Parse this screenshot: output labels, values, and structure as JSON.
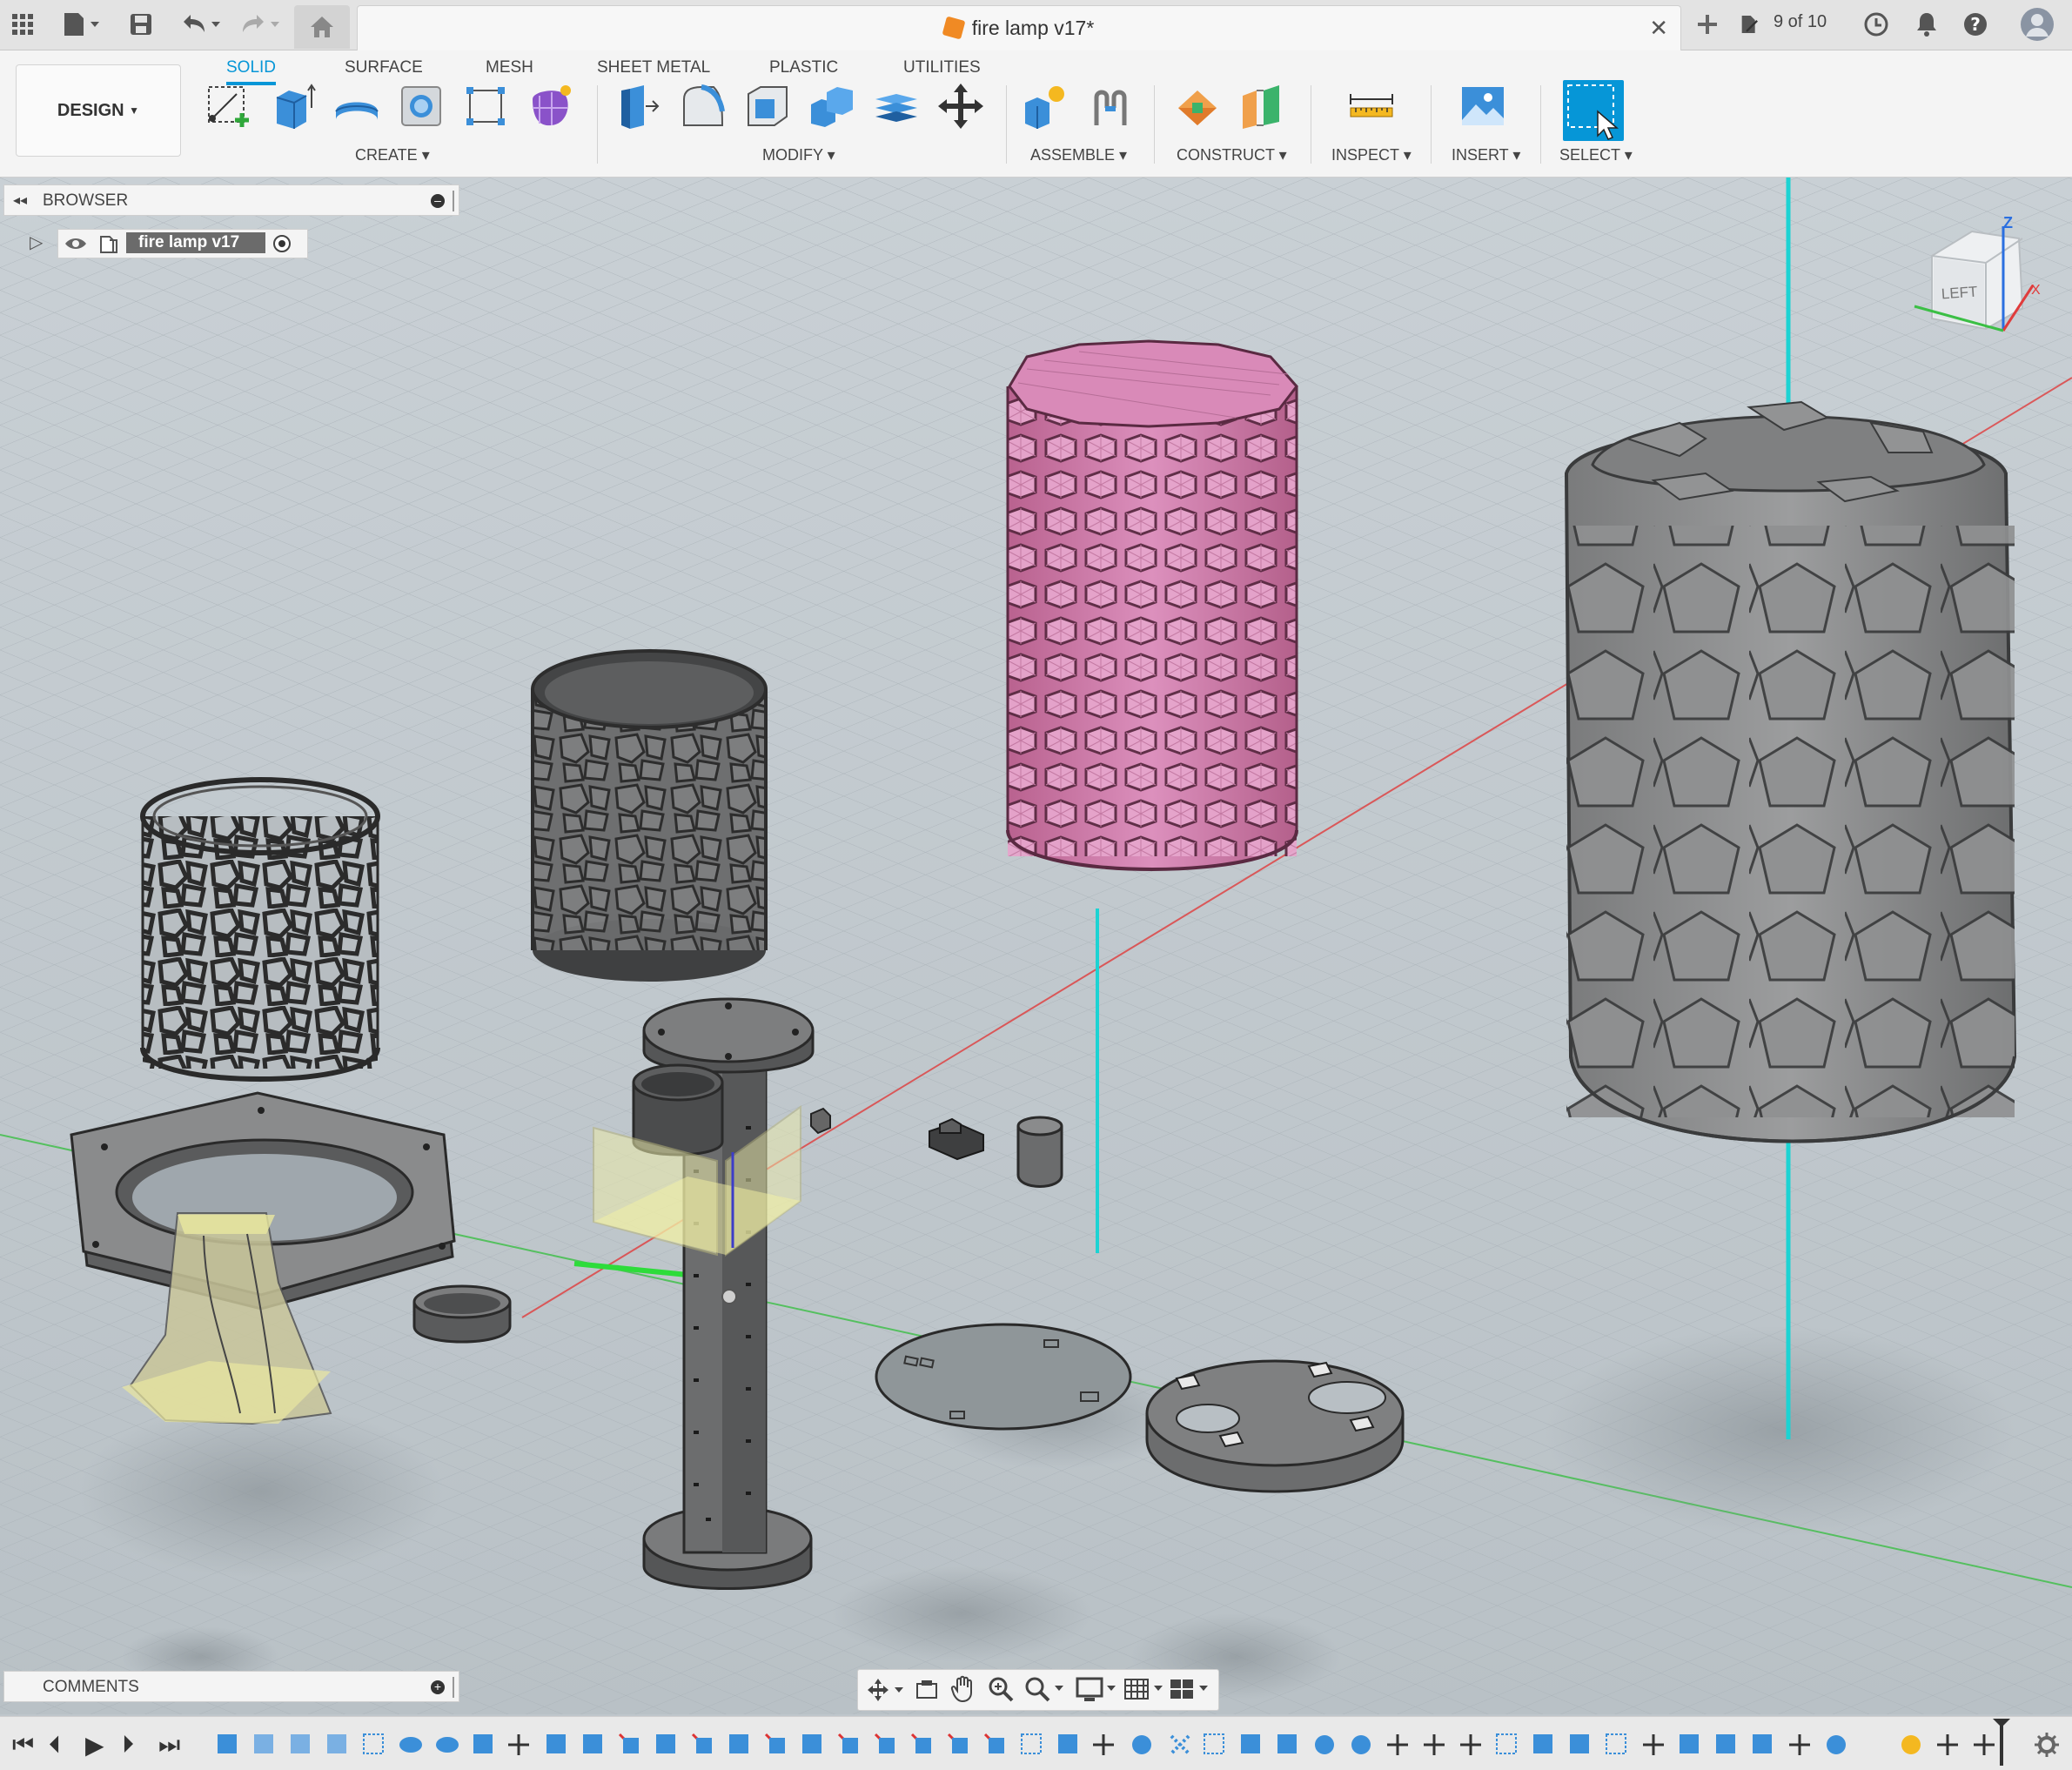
{
  "app": {
    "document_title": "fire lamp v17*",
    "job_status": "9 of 10"
  },
  "workspace": {
    "design_label": "DESIGN",
    "tabs": [
      "SOLID",
      "SURFACE",
      "MESH",
      "SHEET METAL",
      "PLASTIC",
      "UTILITIES"
    ],
    "active_tab": "SOLID"
  },
  "toolbar_groups": {
    "create": "CREATE",
    "modify": "MODIFY",
    "assemble": "ASSEMBLE",
    "construct": "CONSTRUCT",
    "inspect": "INSPECT",
    "insert": "INSERT",
    "select": "SELECT"
  },
  "browser": {
    "title": "BROWSER",
    "root_item": "fire lamp v17"
  },
  "comments": {
    "title": "COMMENTS"
  },
  "viewcube": {
    "face_label": "LEFT",
    "axis_z": "Z",
    "axis_x": "X"
  },
  "colors": {
    "accent": "#0696d7",
    "selected_body": "#d98ab8",
    "grid_background": "#c3cacf",
    "axis_cyan": "#1cd3d3"
  }
}
